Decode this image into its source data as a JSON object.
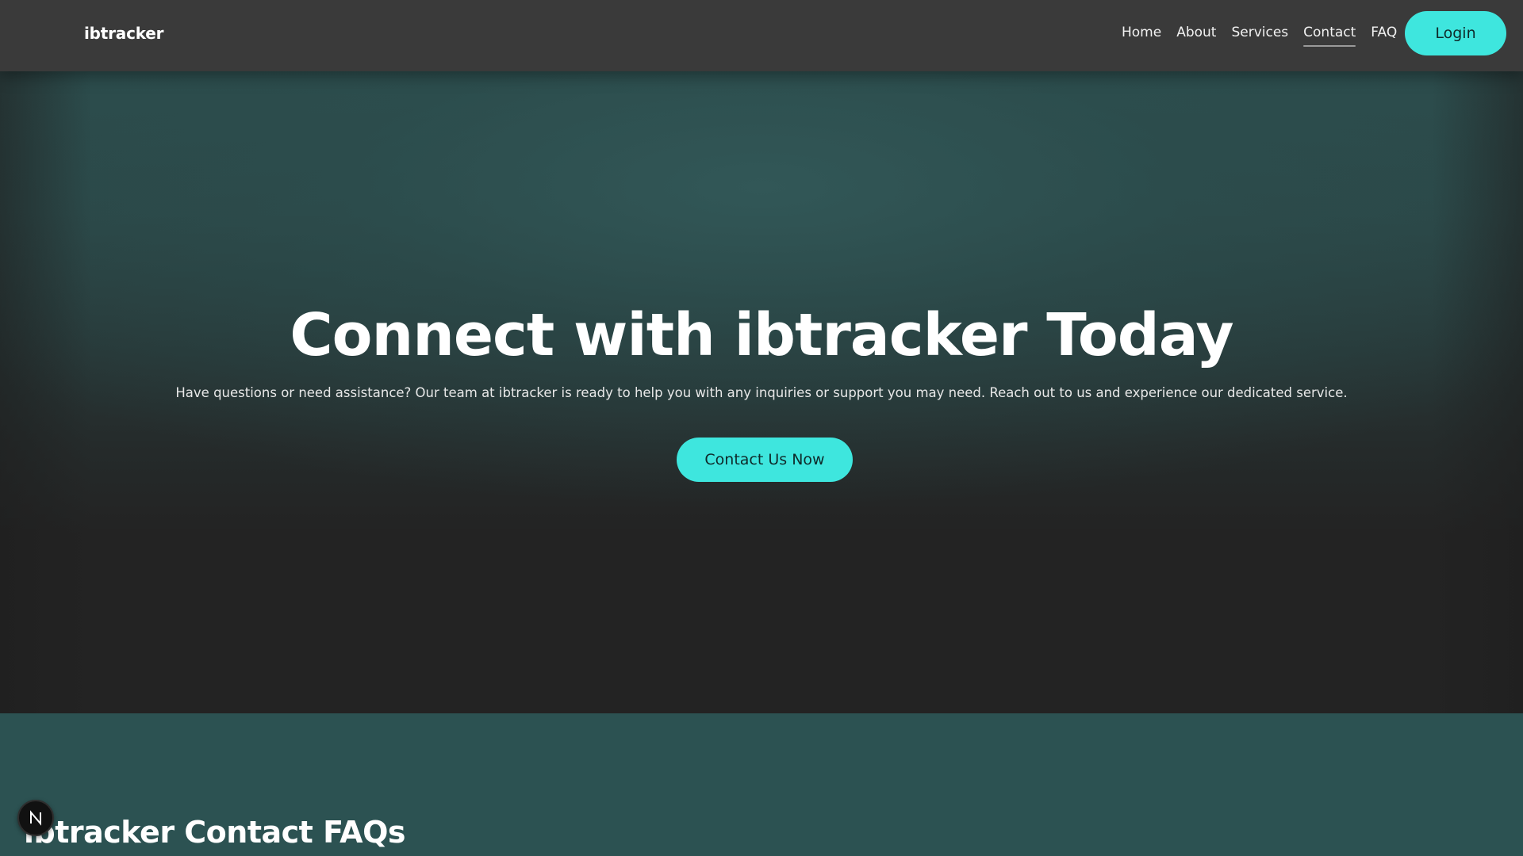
{
  "header": {
    "brand": "ibtracker",
    "nav": [
      {
        "label": "Home",
        "active": false
      },
      {
        "label": "About",
        "active": false
      },
      {
        "label": "Services",
        "active": false
      },
      {
        "label": "Contact",
        "active": true
      },
      {
        "label": "FAQ",
        "active": false
      }
    ],
    "login_label": "Login"
  },
  "hero": {
    "title": "Connect with ibtracker Today",
    "subtitle": "Have questions or need assistance? Our team at ibtracker is ready to help you with any inquiries or support you may need. Reach out to us and experience our dedicated service.",
    "cta_label": "Contact Us Now"
  },
  "faq": {
    "heading": "ibtracker Contact FAQs"
  },
  "badge": {
    "icon": "n-logo-icon"
  },
  "colors": {
    "accent": "#3ee6de",
    "header_bg": "#3a3a3a",
    "hero_teal": "#2c4c4c",
    "dark_bg": "#232323",
    "faq_bg": "#2c5252"
  }
}
